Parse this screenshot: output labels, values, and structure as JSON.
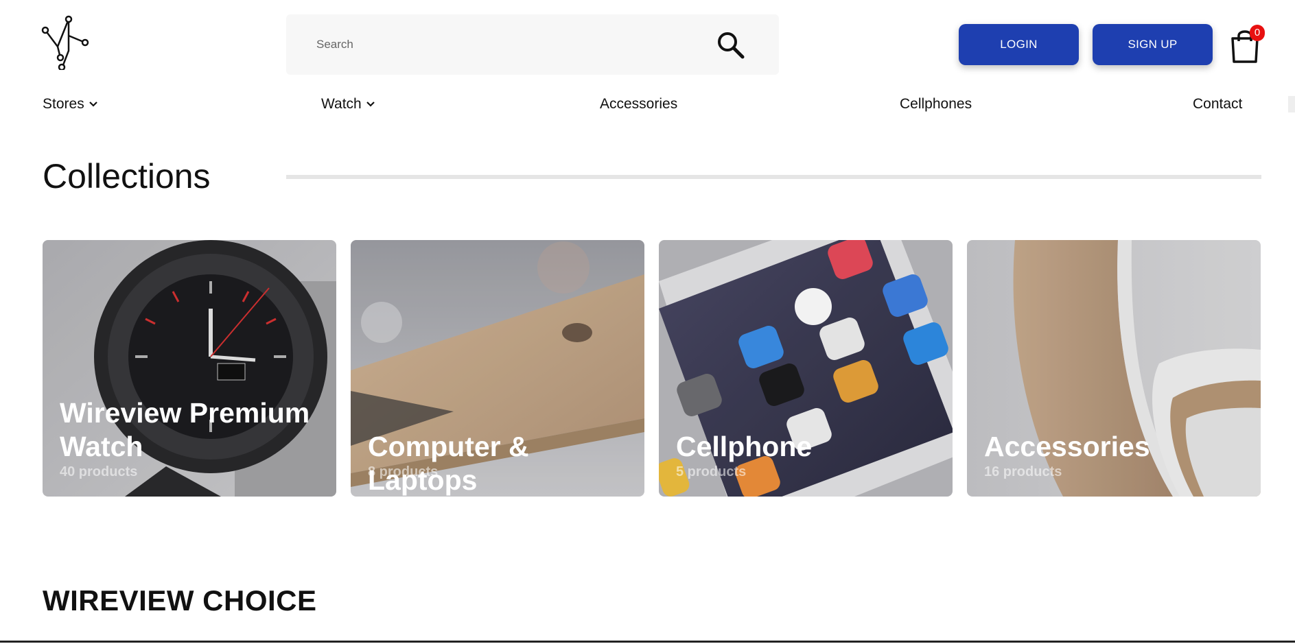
{
  "header": {
    "search": {
      "placeholder": "Search",
      "value": ""
    },
    "login_label": "LOGIN",
    "signup_label": "SIGN UP",
    "cart_count": "0"
  },
  "nav": {
    "items": [
      {
        "label": "Stores",
        "has_dropdown": true
      },
      {
        "label": "Watch",
        "has_dropdown": true
      },
      {
        "label": "Accessories",
        "has_dropdown": false
      },
      {
        "label": "Cellphones",
        "has_dropdown": false
      },
      {
        "label": "Contact",
        "has_dropdown": false
      }
    ]
  },
  "collections": {
    "title": "Collections",
    "cards": [
      {
        "title": "Wireview Premium Watch",
        "count": "40 products"
      },
      {
        "title": "Computer & Laptops",
        "count": "8 products"
      },
      {
        "title": "Cellphone",
        "count": "5 products"
      },
      {
        "title": "Accessories",
        "count": "16 products"
      }
    ]
  },
  "choice": {
    "title": "WIREVIEW CHOICE"
  },
  "colors": {
    "accent": "#1e3fb0",
    "badge": "#e81010",
    "text": "#111111",
    "search_bg": "#f7f7f7"
  }
}
